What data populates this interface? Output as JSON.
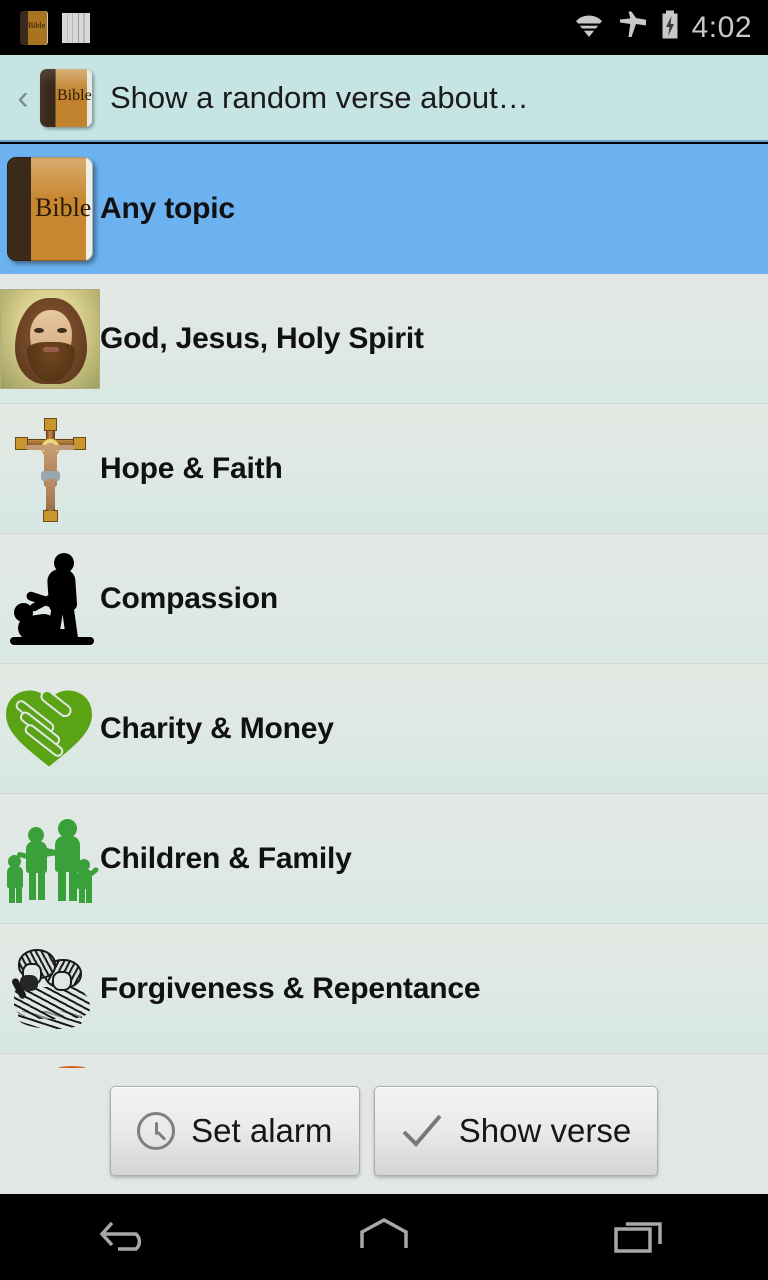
{
  "status_bar": {
    "notification_icons": [
      {
        "name": "bible-app-notification-icon",
        "label": "Bible"
      },
      {
        "name": "pages-notification-icon",
        "label": ""
      }
    ],
    "wifi_icon": "wifi-icon",
    "airplane_icon": "airplane-mode-icon",
    "battery_icon": "battery-charging-icon",
    "time": "4:02"
  },
  "action_bar": {
    "back_label": "‹",
    "app_icon_label": "Bible",
    "title": "Show a random verse about…",
    "background": "#C6E4E4",
    "accent_underline": "#5FA4CF"
  },
  "list": {
    "selected_index": 0,
    "selected_color": "#6CB2F0",
    "row_background": "#E2E7E3",
    "items": [
      {
        "label": "Any topic",
        "icon": "bible-book-icon",
        "selected": true
      },
      {
        "label": "God, Jesus, Holy Spirit",
        "icon": "jesus-portrait-icon",
        "selected": false
      },
      {
        "label": "Hope & Faith",
        "icon": "crucifix-icon",
        "selected": false
      },
      {
        "label": "Compassion",
        "icon": "helping-hand-silhouette-icon",
        "selected": false
      },
      {
        "label": "Charity & Money",
        "icon": "heart-handshake-icon",
        "selected": false
      },
      {
        "label": "Children & Family",
        "icon": "family-silhouette-icon",
        "selected": false
      },
      {
        "label": "Forgiveness & Repentance",
        "icon": "embrace-sketch-icon",
        "selected": false
      }
    ]
  },
  "button_bar": {
    "set_alarm": {
      "label": "Set alarm",
      "icon": "clock-icon"
    },
    "show_verse": {
      "label": "Show verse",
      "icon": "check-icon"
    }
  },
  "nav_bar": {
    "back": "back-nav-icon",
    "home": "home-nav-icon",
    "recents": "recents-nav-icon"
  }
}
